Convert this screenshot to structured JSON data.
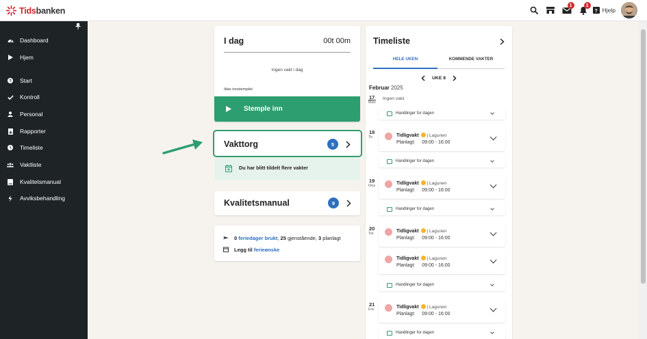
{
  "header": {
    "logo": {
      "part1": "Tids",
      "part2": "banken"
    },
    "help_label": "Hjelp",
    "messages_badge": "1",
    "notifications_badge": "1"
  },
  "sidebar": {
    "items": [
      {
        "label": "Dashboard",
        "icon": "dashboard-icon"
      },
      {
        "label": "Hjem",
        "icon": "play-icon"
      },
      {
        "label": "Start",
        "icon": "question-icon"
      },
      {
        "label": "Kontroll",
        "icon": "check-icon"
      },
      {
        "label": "Personal",
        "icon": "person-icon"
      },
      {
        "label": "Rapporter",
        "icon": "report-icon"
      },
      {
        "label": "Timeliste",
        "icon": "clock-icon"
      },
      {
        "label": "Vaktliste",
        "icon": "users-icon"
      },
      {
        "label": "Kvalitetsmanual",
        "icon": "book-icon"
      },
      {
        "label": "Avviksbehandling",
        "icon": "bolt-icon"
      }
    ]
  },
  "today": {
    "title": "I dag",
    "hours": "00t 00m",
    "no_shift": "Ingen vakt i dag",
    "status": "Ikke innstemplet",
    "stamp_button": "Stemple inn"
  },
  "vakttorg": {
    "title": "Vakttorg",
    "count": "5",
    "notice": "Du har blitt tildelt flere vakter"
  },
  "kvalitetsmanual": {
    "title": "Kvalitetsmanual",
    "count": "9"
  },
  "vacation": {
    "used_count": "0",
    "used_link": "feriedager brukt",
    "remaining_count": "25",
    "remaining_text": "gjenstående,",
    "planned_count": "3",
    "planned_text": "planlagt",
    "add_prefix": "Legg til",
    "add_link": "ferieønske"
  },
  "timeliste": {
    "title": "Timeliste",
    "tabs": [
      "HELE UKEN",
      "KOMMENDE VAKTER"
    ],
    "active_tab": 0,
    "week_label": "UKE 8",
    "month": "Februar",
    "year": "2025",
    "action_label": "Handlinger for dagen",
    "days": [
      {
        "num": "17",
        "name": "Man",
        "empty_text": "Ingen vakt"
      },
      {
        "num": "18",
        "name": "Tir"
      },
      {
        "num": "19",
        "name": "Ons"
      },
      {
        "num": "20",
        "name": "Tor"
      },
      {
        "num": "21",
        "name": "Fre"
      }
    ],
    "shift": {
      "name": "Tidligvakt",
      "location": "| Lagunen",
      "planned_label": "Planlagt:",
      "planned_time": "09:00 - 16:00"
    }
  },
  "colors": {
    "accent_green": "#2d9e6f",
    "link_blue": "#2d6fbf",
    "sidebar_bg": "#1e2326",
    "brand_red": "#d4232b"
  }
}
